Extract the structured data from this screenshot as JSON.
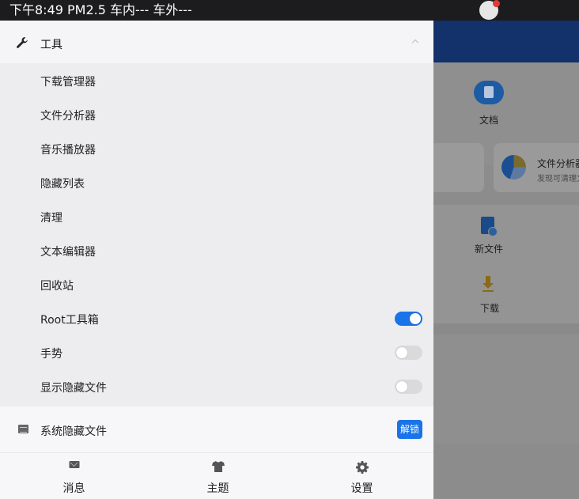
{
  "status_bar": {
    "text": "下午8:49 PM2.5 车内--- 车外---"
  },
  "drawer": {
    "header": {
      "label": "工具"
    },
    "items": [
      {
        "label": "下载管理器"
      },
      {
        "label": "文件分析器"
      },
      {
        "label": "音乐播放器"
      },
      {
        "label": "隐藏列表"
      },
      {
        "label": "清理"
      },
      {
        "label": "文本编辑器"
      },
      {
        "label": "回收站"
      },
      {
        "label": "Root工具箱",
        "toggle": true
      },
      {
        "label": "手势",
        "toggle": false
      },
      {
        "label": "显示隐藏文件",
        "toggle": false
      }
    ],
    "system_hidden": {
      "label": "系统隐藏文件",
      "button": "解锁"
    },
    "bottom_nav": [
      {
        "label": "消息",
        "icon": "mail-icon"
      },
      {
        "label": "主题",
        "icon": "shirt-icon"
      },
      {
        "label": "设置",
        "icon": "gear-icon"
      }
    ]
  },
  "background_app": {
    "doc_label": "文档",
    "card_title": "文件分析器",
    "card_subtitle": "发现可清理文",
    "new_file_label": "新文件",
    "download_label": "下载"
  },
  "colors": {
    "accent": "#1a73e8",
    "header_bg": "#13316a"
  }
}
